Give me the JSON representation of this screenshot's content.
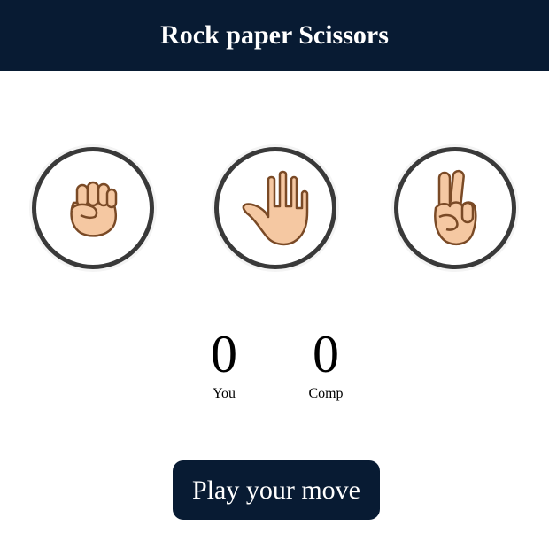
{
  "header": {
    "title": "Rock paper Scissors"
  },
  "choices": [
    {
      "id": "rock",
      "icon": "fist-icon"
    },
    {
      "id": "paper",
      "icon": "open-hand-icon"
    },
    {
      "id": "scissors",
      "icon": "victory-hand-icon"
    }
  ],
  "scores": {
    "user": {
      "value": "0",
      "label": "You"
    },
    "comp": {
      "value": "0",
      "label": "Comp"
    }
  },
  "message": {
    "text": "Play your move"
  },
  "colors": {
    "header_bg": "#081b33",
    "ring": "#393939",
    "skin": "#f5c8a2",
    "outline": "#7a4a26"
  }
}
